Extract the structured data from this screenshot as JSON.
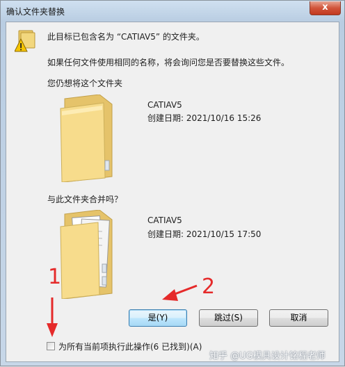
{
  "window": {
    "title": "确认文件夹替换",
    "close_glyph": "x"
  },
  "message": {
    "line1": "此目标已包含名为 “CATIAV5” 的文件夹。",
    "line2": "如果任何文件使用相同的名称，将会询问您是否要替换这些文件。",
    "line3": "您仍想将这个文件夹"
  },
  "target_folder": {
    "name": "CATIAV5",
    "created": "创建日期: 2021/10/16 15:26"
  },
  "merge_prompt": "与此文件夹合并吗？",
  "source_folder": {
    "name": "CATIAV5",
    "created": "创建日期: 2021/10/15 17:50"
  },
  "buttons": {
    "yes": "是(Y)",
    "skip": "跳过(S)",
    "cancel": "取消"
  },
  "apply_all": {
    "label": "为所有当前项执行此操作(6 已找到)(A)",
    "checked": false
  },
  "annotations": {
    "label1": "1",
    "label2": "2",
    "color": "#e52a2a"
  },
  "watermark": "知乎 @UG模具设计铭程老师"
}
